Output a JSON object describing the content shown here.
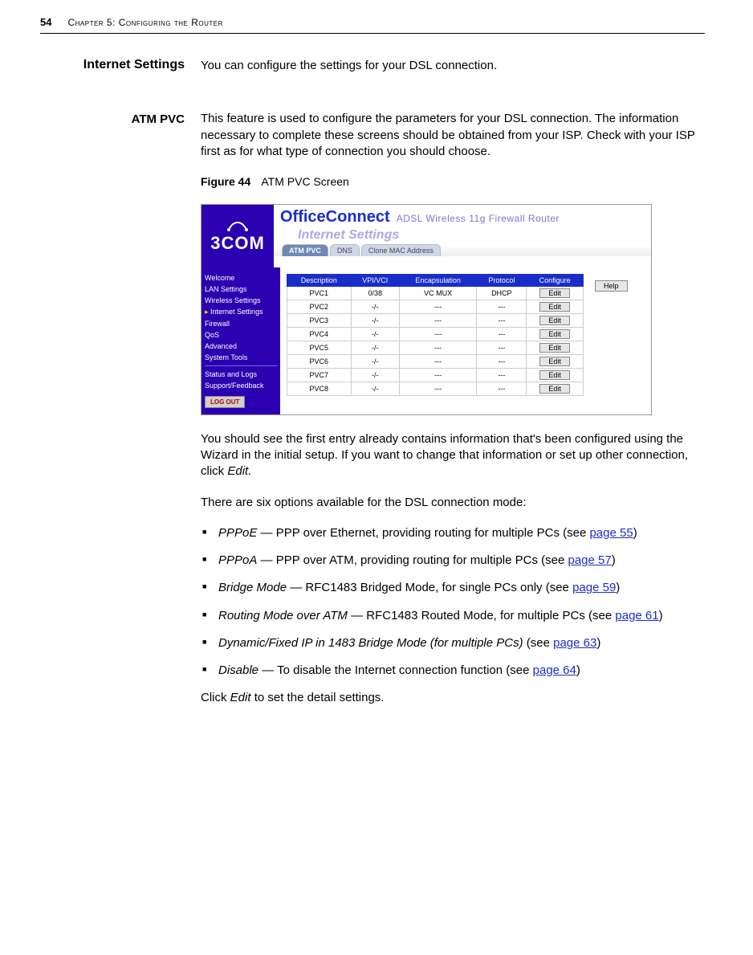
{
  "header": {
    "page_number": "54",
    "chapter_title": "Chapter 5: Configuring the Router"
  },
  "section_heading": "Internet Settings",
  "section_intro": "You can configure the settings for your DSL connection.",
  "subsection_heading": "ATM PVC",
  "subsection_body": "This feature is used to configure the parameters for your DSL connection. The information necessary to complete these screens should be obtained from your ISP. Check with your ISP first as for what type of connection you should choose.",
  "figure": {
    "label": "Figure 44",
    "caption": "ATM PVC Screen"
  },
  "screenshot": {
    "logo_text": "3COM",
    "brand": "OfficeConnect",
    "brand_sub": "ADSL Wireless 11g Firewall Router",
    "section_title": "Internet Settings",
    "tabs": [
      "ATM PVC",
      "DNS",
      "Clone MAC Address"
    ],
    "sidebar": [
      "Welcome",
      "LAN Settings",
      "Wireless Settings",
      "Internet Settings",
      "Firewall",
      "QoS",
      "Advanced",
      "System Tools",
      "Status and Logs",
      "Support/Feedback"
    ],
    "logout": "LOG OUT",
    "table_headers": [
      "Description",
      "VPI/VCI",
      "Encapsulation",
      "Protocol",
      "Configure"
    ],
    "table_rows": [
      {
        "desc": "PVC1",
        "vpi": "0/38",
        "encap": "VC MUX",
        "proto": "DHCP"
      },
      {
        "desc": "PVC2",
        "vpi": "-/-",
        "encap": "---",
        "proto": "---"
      },
      {
        "desc": "PVC3",
        "vpi": "-/-",
        "encap": "---",
        "proto": "---"
      },
      {
        "desc": "PVC4",
        "vpi": "-/-",
        "encap": "---",
        "proto": "---"
      },
      {
        "desc": "PVC5",
        "vpi": "-/-",
        "encap": "---",
        "proto": "---"
      },
      {
        "desc": "PVC6",
        "vpi": "-/-",
        "encap": "---",
        "proto": "---"
      },
      {
        "desc": "PVC7",
        "vpi": "-/-",
        "encap": "---",
        "proto": "---"
      },
      {
        "desc": "PVC8",
        "vpi": "-/-",
        "encap": "---",
        "proto": "---"
      }
    ],
    "edit_label": "Edit",
    "help_label": "Help"
  },
  "after_figure_p1": "You should see the first entry already contains information that's been configured using the Wizard in the initial setup. If you want to change that information or set up other connection, click ",
  "after_figure_p1_em": "Edit.",
  "options_intro": "There are six options available for the DSL connection mode:",
  "options": [
    {
      "name": "PPPoE",
      "dash": " — ",
      "desc": "PPP over Ethernet, providing routing for multiple PCs (see ",
      "page": "page 55",
      "close": ")"
    },
    {
      "name": "PPPoA",
      "dash": " — ",
      "desc": "PPP over ATM, providing routing for multiple PCs (see ",
      "page": "page 57",
      "close": ")"
    },
    {
      "name": "Bridge Mode",
      "dash": " — ",
      "desc": "RFC1483 Bridged Mode, for single PCs only (see ",
      "page": "page 59",
      "close": ")"
    },
    {
      "name": "Routing Mode over ATM",
      "dash": " — ",
      "desc": "RFC1483 Routed Mode, for multiple PCs (see ",
      "page": "page 61",
      "close": ")"
    },
    {
      "name": "Dynamic/Fixed IP in 1483 Bridge Mode (for multiple PCs)",
      "dash": " ",
      "desc": "(see ",
      "page": "page 63",
      "close": ")"
    },
    {
      "name": "Disable",
      "dash": " — ",
      "desc": "To disable the Internet connection function (see ",
      "page": "page 64",
      "close": ")"
    }
  ],
  "closing": {
    "pre": "Click ",
    "em": "Edit",
    "post": " to set the detail settings."
  }
}
